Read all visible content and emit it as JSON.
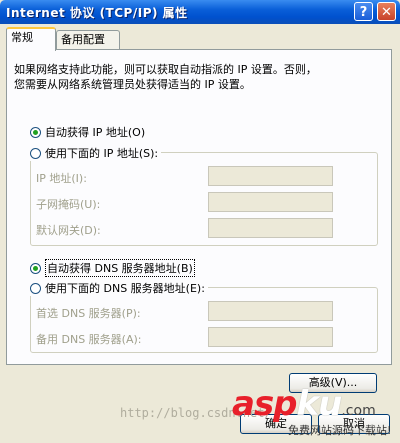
{
  "window": {
    "title": "Internet 协议 (TCP/IP) 属性",
    "help_glyph": "?",
    "close_glyph": "✕"
  },
  "tabs": [
    {
      "label": "常规"
    },
    {
      "label": "备用配置"
    }
  ],
  "description": {
    "line1": "如果网络支持此功能，则可以获取自动指派的 IP 设置。否则，",
    "line2": "您需要从网络系统管理员处获得适当的 IP 设置。"
  },
  "ip": {
    "auto_label": "自动获得 IP 地址(O)",
    "auto_selected": true,
    "manual_label": "使用下面的 IP 地址(S):",
    "fields": [
      {
        "label": "IP 地址(I):",
        "value": ""
      },
      {
        "label": "子网掩码(U):",
        "value": ""
      },
      {
        "label": "默认网关(D):",
        "value": ""
      }
    ]
  },
  "dns": {
    "auto_label": "自动获得 DNS 服务器地址(B)",
    "auto_selected": true,
    "manual_label": "使用下面的 DNS 服务器地址(E):",
    "fields": [
      {
        "label": "首选 DNS 服务器(P):",
        "value": ""
      },
      {
        "label": "备用 DNS 服务器(A):",
        "value": ""
      }
    ]
  },
  "buttons": {
    "advanced": "高级(V)...",
    "ok": "确定",
    "cancel": "取消"
  },
  "watermark": {
    "url": "http://blog.csdn.net/",
    "logo_asp": "asp",
    "logo_ku": "ku",
    "logo_com": ".com",
    "logo_sub": "免费网站源码下载站!"
  }
}
